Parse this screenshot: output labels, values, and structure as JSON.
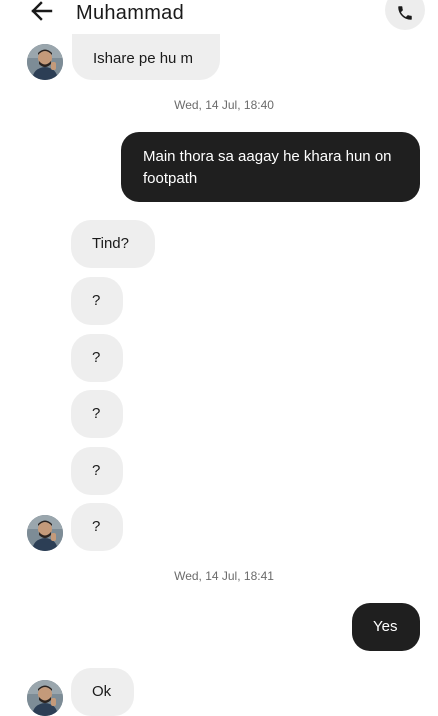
{
  "header": {
    "contact_name": "Muhammad",
    "back_icon": "arrow-left-icon",
    "call_icon": "phone-icon"
  },
  "messages": [
    {
      "from": "them",
      "text": "Ishare pe hu m"
    },
    {
      "timestamp": "Wed, 14 Jul, 18:40"
    },
    {
      "from": "me",
      "text": "Main thora sa aagay he khara hun on footpath"
    },
    {
      "from": "them",
      "text": "Tind?"
    },
    {
      "from": "them",
      "text": "?"
    },
    {
      "from": "them",
      "text": "?"
    },
    {
      "from": "them",
      "text": "?"
    },
    {
      "from": "them",
      "text": "?"
    },
    {
      "from": "them",
      "text": "?"
    },
    {
      "timestamp": "Wed, 14 Jul, 18:41"
    },
    {
      "from": "me",
      "text": "Yes"
    },
    {
      "from": "them",
      "text": "Ok"
    }
  ],
  "colors": {
    "incoming_bubble": "#eeeeee",
    "outgoing_bubble": "#1f1f1f",
    "timestamp_text": "#6b6b6b"
  }
}
